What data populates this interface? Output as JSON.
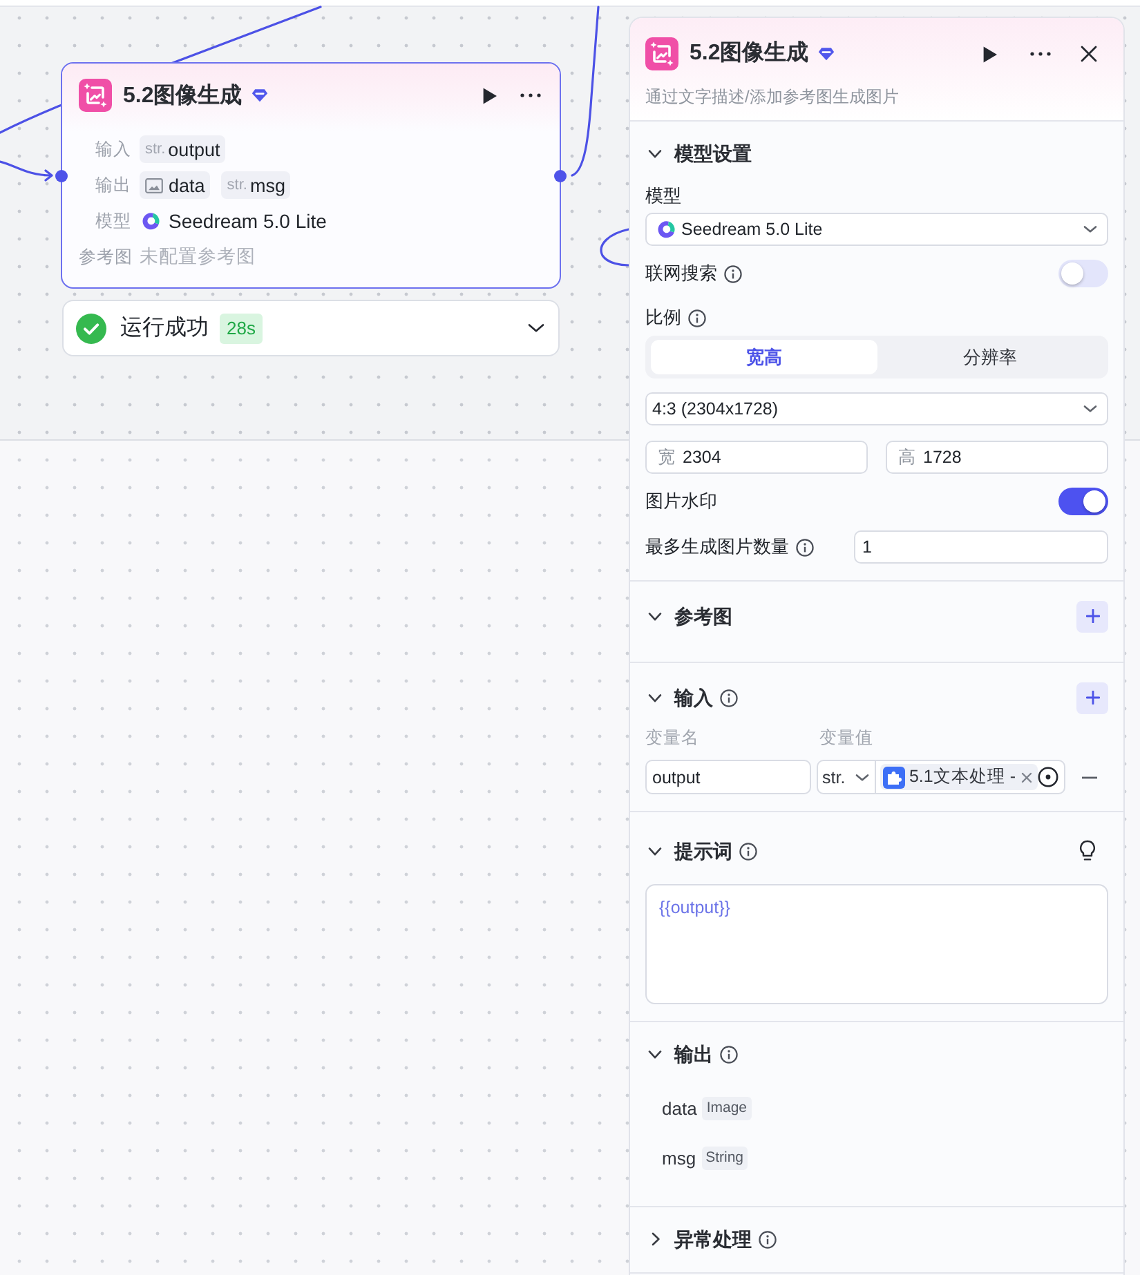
{
  "canvas": {
    "node": {
      "title": "5.2图像生成",
      "rows": [
        {
          "label": "输入",
          "values": [
            {
              "kind": "string",
              "prefix": "str.",
              "text": "output"
            }
          ]
        },
        {
          "label": "输出",
          "values": [
            {
              "kind": "image",
              "text": "data"
            },
            {
              "kind": "string",
              "prefix": "str.",
              "text": "msg"
            }
          ]
        },
        {
          "label": "模型",
          "values": [
            {
              "kind": "model",
              "text": "Seedream 5.0 Lite"
            }
          ]
        },
        {
          "label": "参考图",
          "values": [
            {
              "kind": "empty",
              "text": "未配置参考图"
            }
          ]
        }
      ]
    },
    "run_status": {
      "kind": "success",
      "label": "运行成功",
      "duration": "28s"
    }
  },
  "panel": {
    "title": "5.2图像生成",
    "description": "通过文字描述/添加参考图生成图片",
    "sections": [
      {
        "kind": "model_settings",
        "title": "模型设置",
        "expanded": true,
        "info": false,
        "fields": [
          {
            "kind": "model_select",
            "label": "模型",
            "info": false,
            "value": "Seedream 5.0 Lite"
          },
          {
            "kind": "toggle",
            "label": "联网搜索",
            "info": true,
            "on": false
          },
          {
            "kind": "ratio",
            "label": "比例",
            "info": true,
            "tabs": [
              {
                "label": "宽高",
                "selected": true
              },
              {
                "label": "分辨率",
                "selected": false
              }
            ],
            "preset": "4:3 (2304x1728)",
            "width": {
              "prefix": "宽",
              "value": "2304"
            },
            "height": {
              "prefix": "高",
              "value": "1728"
            }
          },
          {
            "kind": "toggle",
            "label": "图片水印",
            "info": false,
            "on": true
          },
          {
            "kind": "number",
            "label": "最多生成图片数量",
            "info": true,
            "value": "1"
          }
        ]
      },
      {
        "kind": "reference",
        "title": "参考图",
        "expanded": true,
        "info": false
      },
      {
        "kind": "inputs",
        "title": "输入",
        "expanded": true,
        "info": true,
        "columns": [
          "变量名",
          "变量值"
        ],
        "rows": [
          {
            "name": "output",
            "type": "str.",
            "source": "5.1文本处理 -"
          }
        ]
      },
      {
        "kind": "prompt",
        "title": "提示词",
        "expanded": true,
        "info": true,
        "value": "{{output}}"
      },
      {
        "kind": "outputs",
        "title": "输出",
        "expanded": true,
        "info": true,
        "items": [
          {
            "name": "data",
            "type": "Image"
          },
          {
            "name": "msg",
            "type": "String"
          }
        ]
      },
      {
        "kind": "error_handling",
        "title": "异常处理",
        "expanded": false,
        "info": true
      }
    ]
  }
}
